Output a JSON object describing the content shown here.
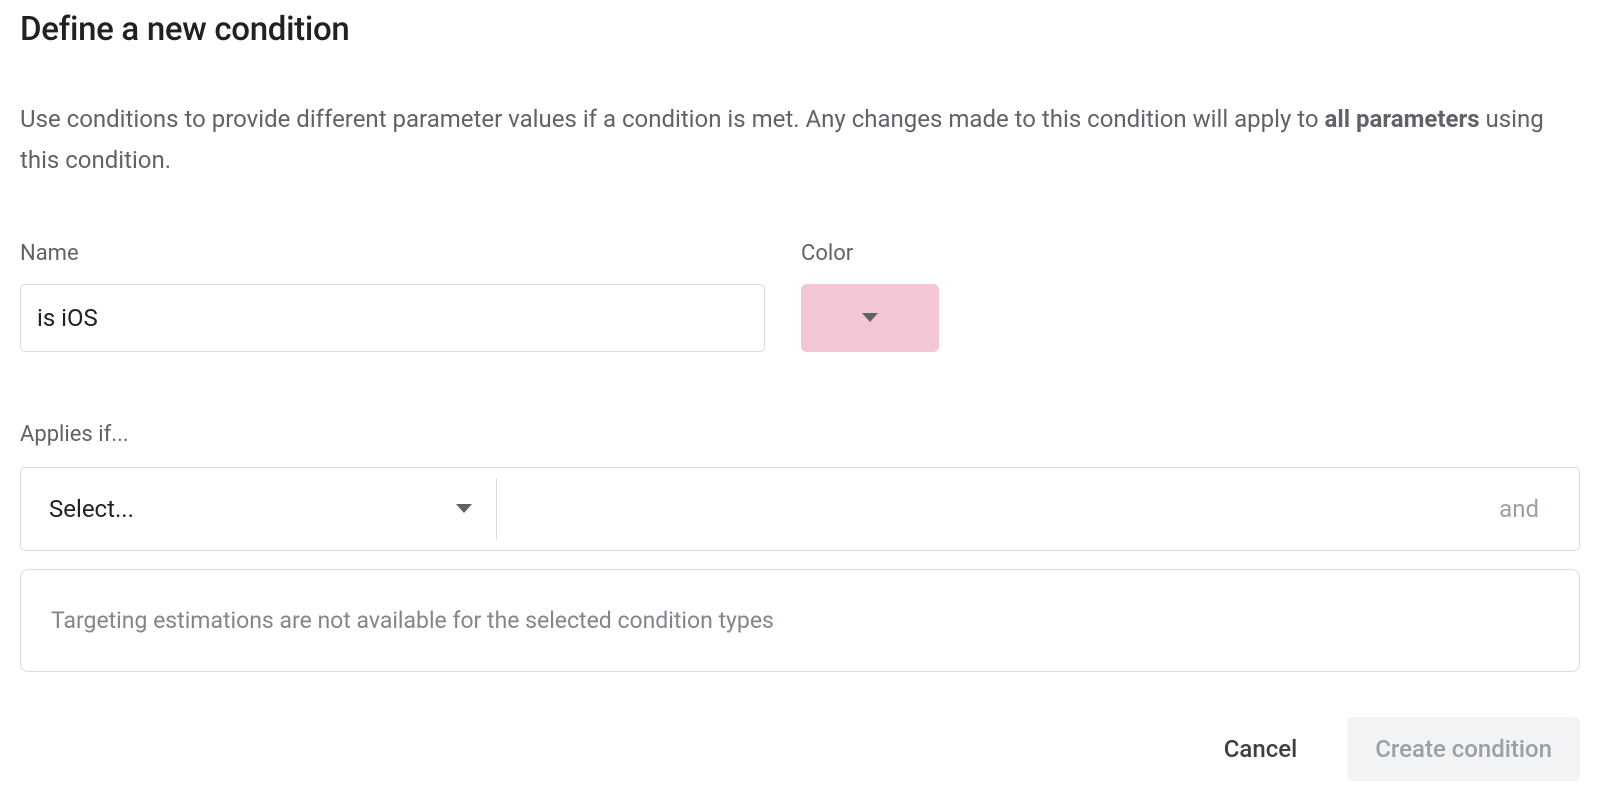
{
  "title": "Define a new condition",
  "description": {
    "prefix": "Use conditions to provide different parameter values if a condition is met. Any changes made to this condition will apply to ",
    "bold": "all parameters",
    "suffix": " using this condition."
  },
  "form": {
    "name_label": "Name",
    "name_value": "is iOS",
    "color_label": "Color",
    "color_hex": "#f3c6d4"
  },
  "applies_if": {
    "label": "Applies if...",
    "select_placeholder": "Select...",
    "and_label": "and"
  },
  "info": {
    "message": "Targeting estimations are not available for the selected condition types"
  },
  "buttons": {
    "cancel": "Cancel",
    "create": "Create condition"
  }
}
